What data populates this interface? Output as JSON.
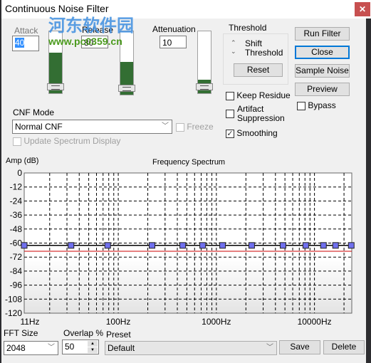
{
  "window": {
    "title": "Continuous Noise Filter",
    "close_icon": "close-icon"
  },
  "watermark": {
    "name": "河东软件园",
    "url": "www.pc0359.cn"
  },
  "attack": {
    "label": "Attack",
    "value": "40",
    "level": 0.65
  },
  "release": {
    "label": "Release",
    "value": "80",
    "level": 0.52
  },
  "attenuation": {
    "label": "Attenuation",
    "value": "10",
    "level": 0.22
  },
  "threshold": {
    "label": "Threshold",
    "shift": "Shift",
    "threshold": "Threshold",
    "reset": "Reset"
  },
  "options": {
    "keep_residue": {
      "label": "Keep Residue",
      "checked": false
    },
    "artifact": {
      "label1": "Artifact",
      "label2": "Suppression",
      "checked": false
    },
    "smoothing": {
      "label": "Smoothing",
      "checked": true
    },
    "bypass": {
      "label": "Bypass",
      "checked": false
    }
  },
  "buttons": {
    "run": "Run Filter",
    "close": "Close",
    "sample": "Sample Noise",
    "preview": "Preview"
  },
  "cnf": {
    "label": "CNF Mode",
    "value": "Normal CNF",
    "freeze": "Freeze",
    "update": "Update Spectrum Display"
  },
  "chart_data": {
    "type": "line",
    "title": "Frequency Spectrum",
    "ylabel": "Amp (dB)",
    "xscale": "log",
    "xlim": [
      11,
      24000
    ],
    "ylim": [
      -120,
      0
    ],
    "yticks": [
      "0",
      "-12",
      "-24",
      "-36",
      "-48",
      "-60",
      "-72",
      "-84",
      "-96",
      "-108",
      "-120"
    ],
    "xticks": [
      {
        "f": 11,
        "label": "11Hz"
      },
      {
        "f": 100,
        "label": "100Hz"
      },
      {
        "f": 1000,
        "label": "1000Hz"
      },
      {
        "f": 10000,
        "label": "10000Hz"
      }
    ],
    "grid": true,
    "series": [
      {
        "color": "#000000",
        "points": [
          [
            11,
            -62
          ],
          [
            33,
            -62
          ],
          [
            78,
            -62
          ],
          [
            221,
            -62
          ],
          [
            454,
            -62
          ],
          [
            725,
            -62
          ],
          [
            1157,
            -62
          ],
          [
            2290,
            -62
          ],
          [
            4780,
            -62
          ],
          [
            8150,
            -62
          ],
          [
            12350,
            -62
          ],
          [
            16400,
            -62
          ],
          [
            23700,
            -62
          ]
        ]
      },
      {
        "color": "#cc0000",
        "points": [
          [
            11,
            -67
          ],
          [
            24000,
            -67
          ]
        ]
      }
    ]
  },
  "bottom": {
    "fft_label": "FFT Size",
    "fft_value": "2048",
    "overlap_label": "Overlap %",
    "overlap_value": "50",
    "preset_label": "Preset",
    "preset_value": "Default",
    "save": "Save",
    "delete": "Delete"
  }
}
